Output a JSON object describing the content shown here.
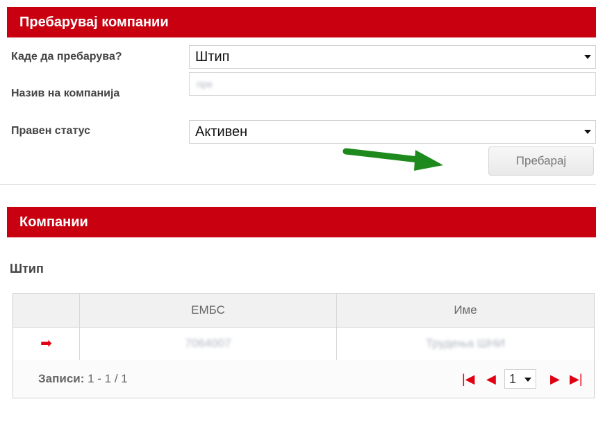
{
  "search_panel": {
    "title": "Пребарувај компании",
    "where_label": "Каде да пребарува?",
    "where_value": "Штип",
    "name_label": "Назив на компанија",
    "name_value": "пре",
    "status_label": "Правен статус",
    "status_value": "Активен",
    "search_button": "Пребарај"
  },
  "results_panel": {
    "title": "Компании",
    "city_heading": "Штип",
    "table": {
      "columns": [
        "ЕМБС",
        "Име"
      ],
      "rows": [
        {
          "embs": "7064007",
          "name": "Трудења ШНИ"
        }
      ]
    },
    "records_label": "Записи:",
    "records_value": "1 - 1 / 1",
    "page_selected": "1"
  },
  "colors": {
    "brand_red": "#c8000f",
    "arrow_green": "#1e8a1e"
  }
}
